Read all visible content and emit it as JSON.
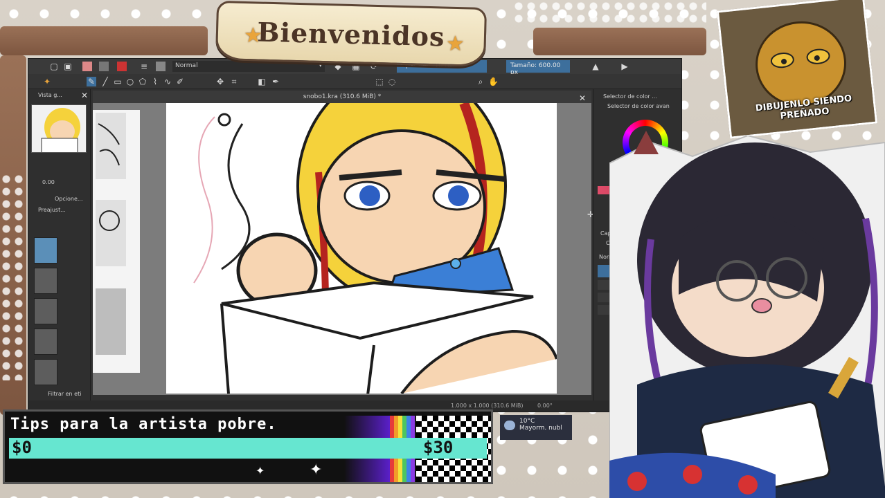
{
  "overlay": {
    "banner_title": "Bienvenidos"
  },
  "krita": {
    "blend_mode": "Normal",
    "opacity_label": "Opacidad: 100%",
    "size_label": "Tamaño: 600.00 px",
    "document_title": "snobo1.kra (310.6 MiB) *",
    "left_dock": {
      "overview_title": "Vista g...",
      "opacity_value": "0.00",
      "tool_options": "Opcione...",
      "presets_title": "Preajust...",
      "filter_label": "Filtrar en eti"
    },
    "right_dock": {
      "color_selector_title": "Selector de color ...",
      "color_selector_sub": "Selector de color avan",
      "layers_title": "Capas",
      "layers_sub": "Capas",
      "layer_blend": "Normal"
    },
    "status_bar": {
      "zoom": "1.000 x 1.000 (310.6 MiB)",
      "rotation": "0.00°"
    }
  },
  "meme": {
    "caption": "DIBUJENLO SIENDO PREÑADO"
  },
  "tips": {
    "title": "Tips para la artista pobre.",
    "min_label": "$0",
    "max_label": "$30",
    "progress": 0.0
  },
  "weather": {
    "temp": "10°C",
    "desc": "Mayorm. nubl"
  },
  "colors": {
    "krita_bg": "#313131",
    "accent_blue": "#3d6f9c",
    "tips_bar": "#66e6d0",
    "banner": "#f6ecd0"
  }
}
